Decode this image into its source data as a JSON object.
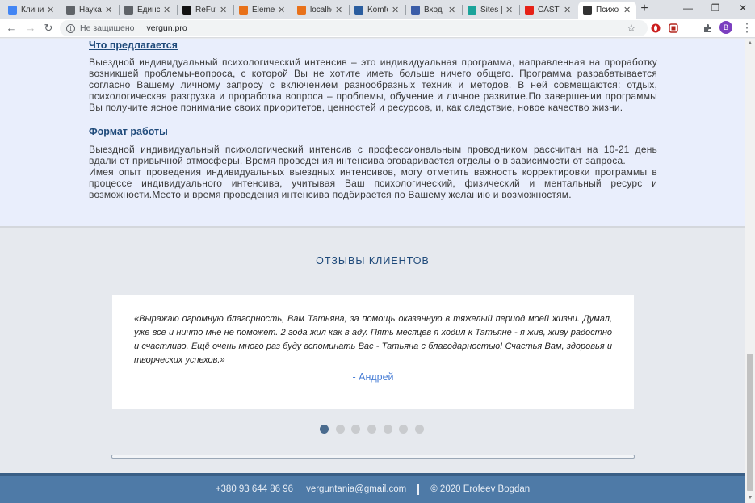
{
  "browser": {
    "tabs": [
      {
        "label": "Клиник",
        "icon": "docs-icon",
        "color": "#4285f4"
      },
      {
        "label": "Наука",
        "icon": "globe-icon",
        "color": "#5f6368"
      },
      {
        "label": "Единст",
        "icon": "globe-icon",
        "color": "#5f6368"
      },
      {
        "label": "ReFutu",
        "icon": "refuture-icon",
        "color": "#111111"
      },
      {
        "label": "Elemen",
        "icon": "elementor-icon",
        "color": "#e8711a"
      },
      {
        "label": "localho",
        "icon": "localhost-icon",
        "color": "#e8711a"
      },
      {
        "label": "Komfor",
        "icon": "komfort-icon",
        "color": "#2a5d9f"
      },
      {
        "label": "Вход в",
        "icon": "login-icon",
        "color": "#3b5da8"
      },
      {
        "label": "Sites | ",
        "icon": "sites-icon",
        "color": "#1aa39a"
      },
      {
        "label": "CASTLI",
        "icon": "youtube-icon",
        "color": "#e62117"
      },
      {
        "label": "Психо",
        "icon": "psy-icon",
        "color": "#333333",
        "active": true
      }
    ],
    "security_label": "Не защищено",
    "url": "vergun.pro",
    "profile_initial": "B"
  },
  "about": {
    "offer_heading": "Что предлагается",
    "offer_text": "Выездной индивидуальный психологический интенсив – это индивидуальная программа, направленная на проработку возникшей проблемы-вопроса, с которой Вы не хотите иметь больше ничего общего. Программа разрабатывается согласно Вашему личному запросу с включением разнообразных техник и методов. В ней совмещаются: отдых, психологическая разгрузка и проработка вопроса – проблемы, обучение и личное развитие.По завершении программы Вы получите ясное понимание своих приоритетов, ценностей и ресурсов, и, как следствие, новое качество жизни.",
    "format_heading": "Формат работы",
    "format_text_1": "Выездной индивидуальный психологический интенсив с профессиональным проводником рассчитан на 10-21 день вдали от привычной атмосферы. Время проведения интенсива оговаривается отдельно в зависимости от запроса.",
    "format_text_2": "Имея опыт проведения индивидуальных выездных интенсивов, могу отметить важность корректировки программы в процессе индивидуального интенсива, учитывая Ваш психологический, физический и ментальный ресурс и возможности.Место и время проведения интенсива подбирается по Вашему желанию и возможностям."
  },
  "reviews": {
    "title": "ОТЗЫВЫ КЛИЕНТОВ",
    "quote": "«Выражаю огромную благорность, Вам Татьяна, за помощь оказанную в тяжелый период моей жизни. Думал, уже все и ничто мне не поможет. 2 года жил как в аду. Пять месяцев я ходил к Татьяне - я жив, живу радостно и счастливо. Ещё очень много раз буду вспоминать Вас - Татьяна с благодарностью! Счастья Вам, здоровья и творческих успехов.»",
    "author": "- Андрей",
    "slide_count": 7,
    "active_slide": 1
  },
  "footer": {
    "phone": "+380 93 644 86 96",
    "email": "verguntania@gmail.com",
    "copyright": "© 2020 Erofeev Bogdan"
  }
}
